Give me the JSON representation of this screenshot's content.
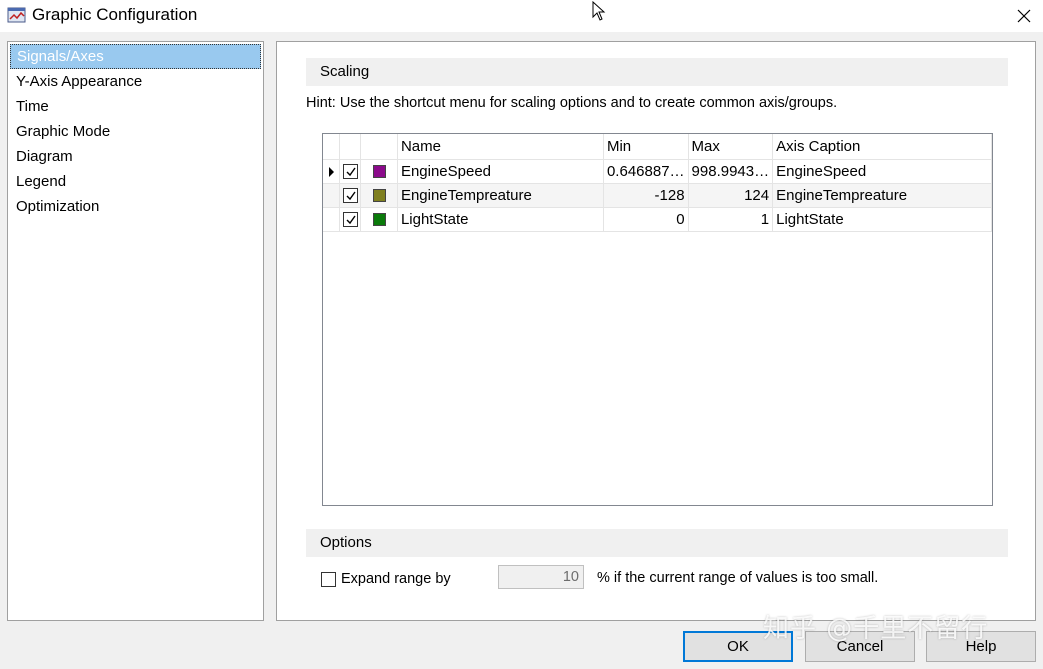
{
  "window": {
    "title": "Graphic Configuration"
  },
  "nav": {
    "items": [
      {
        "label": "Signals/Axes",
        "selected": true
      },
      {
        "label": "Y-Axis Appearance",
        "selected": false
      },
      {
        "label": "Time",
        "selected": false
      },
      {
        "label": "Graphic Mode",
        "selected": false
      },
      {
        "label": "Diagram",
        "selected": false
      },
      {
        "label": "Legend",
        "selected": false
      },
      {
        "label": "Optimization",
        "selected": false
      }
    ]
  },
  "scaling": {
    "header": "Scaling",
    "hint": "Hint: Use the shortcut menu for scaling options and to create common axis/groups.",
    "columns": [
      "Name",
      "Min",
      "Max",
      "Axis Caption"
    ],
    "rows": [
      {
        "name": "EngineSpeed",
        "min": "0.646887…",
        "max": "998.9943…",
        "caption": "EngineSpeed",
        "checked": true,
        "color": "#8b0a8b",
        "current": true
      },
      {
        "name": "EngineTempreature",
        "min": "-128",
        "max": "124",
        "caption": "EngineTempreature",
        "checked": true,
        "color": "#7f7f1f",
        "current": false
      },
      {
        "name": "LightState",
        "min": "0",
        "max": "1",
        "caption": "LightState",
        "checked": true,
        "color": "#0a7a0a",
        "current": false
      }
    ]
  },
  "options": {
    "header": "Options",
    "expand_label": "Expand range by",
    "expand_checked": false,
    "expand_value": "10",
    "expand_suffix": "%  if the current range of values is too small."
  },
  "buttons": {
    "ok": "OK",
    "cancel": "Cancel",
    "help": "Help"
  },
  "watermark": "知乎 @千里不留行",
  "colors": {
    "selection": "#99c9ef",
    "default_button_border": "#0078d7"
  },
  "icons": {
    "close": "close-icon",
    "app": "graphic-window-icon",
    "check": "check-icon"
  }
}
